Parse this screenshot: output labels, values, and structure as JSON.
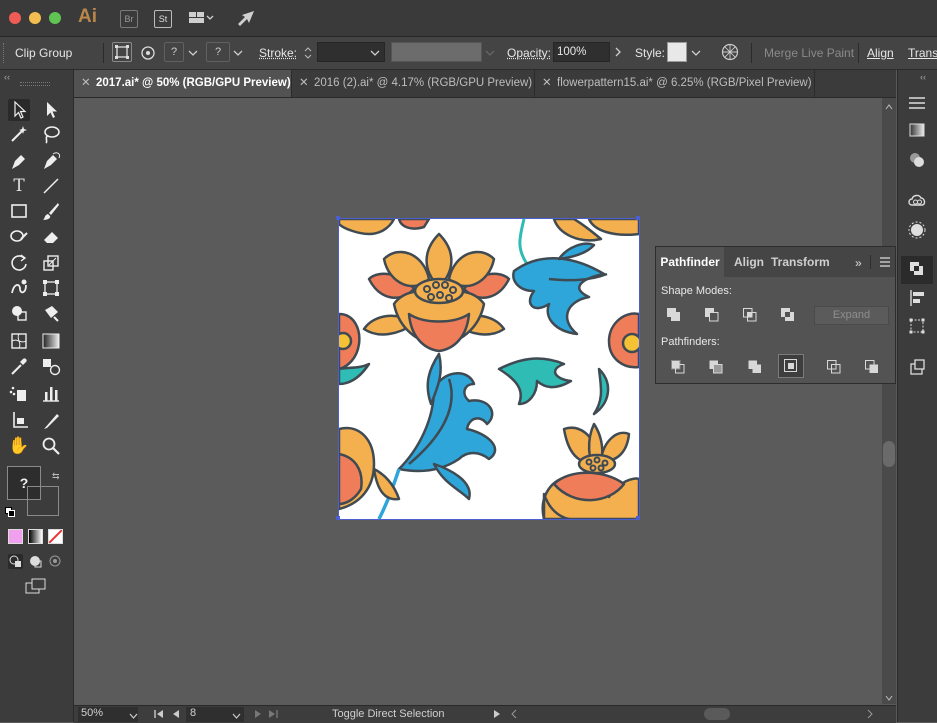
{
  "app": {
    "logo": "Ai",
    "bridge_label": "Br",
    "stock_label": "St"
  },
  "control_bar": {
    "selection": "Clip Group",
    "stroke_label": "Stroke:",
    "opacity_label": "Opacity:",
    "opacity_value": "100%",
    "style_label": "Style:",
    "merge_label": "Merge Live Paint",
    "align_label": "Align",
    "transform_label": "Transf"
  },
  "tabs": [
    {
      "label": "2017.ai* @ 50% (RGB/GPU Preview)",
      "active": true
    },
    {
      "label": "2016 (2).ai* @ 4.17% (RGB/GPU Preview)",
      "active": false
    },
    {
      "label": "flowerpattern15.ai* @ 6.25% (RGB/Pixel Preview)",
      "active": false
    }
  ],
  "pathfinder": {
    "tabs": [
      "Pathfinder",
      "Align",
      "Transform"
    ],
    "shape_modes_label": "Shape Modes:",
    "expand_label": "Expand",
    "pathfinders_label": "Pathfinders:"
  },
  "status": {
    "zoom": "50%",
    "artboard": "8",
    "message": "Toggle Direct Selection"
  },
  "colors": {
    "petal_orange": "#f4b04f",
    "petal_coral": "#ef7d5a",
    "leaf_blue": "#2ea6d9",
    "leaf_teal": "#2fbcb4",
    "outline": "#3f4a52",
    "fill_swatch": "#f0a0ef"
  },
  "icons": [
    "selection-tool-icon",
    "direct-selection-tool-icon",
    "magic-wand-icon",
    "lasso-icon",
    "pen-icon",
    "curvature-icon",
    "type-icon",
    "line-icon",
    "rectangle-icon",
    "paintbrush-icon",
    "shaper-icon",
    "eraser-icon",
    "rotate-icon",
    "scale-icon",
    "warp-icon",
    "free-transform-icon",
    "shape-builder-icon",
    "live-paint-icon",
    "mesh-icon",
    "gradient-icon",
    "eyedropper-icon",
    "blend-icon",
    "symbol-sprayer-icon",
    "column-graph-icon",
    "artboard-icon",
    "slice-icon",
    "hand-icon",
    "zoom-icon"
  ]
}
